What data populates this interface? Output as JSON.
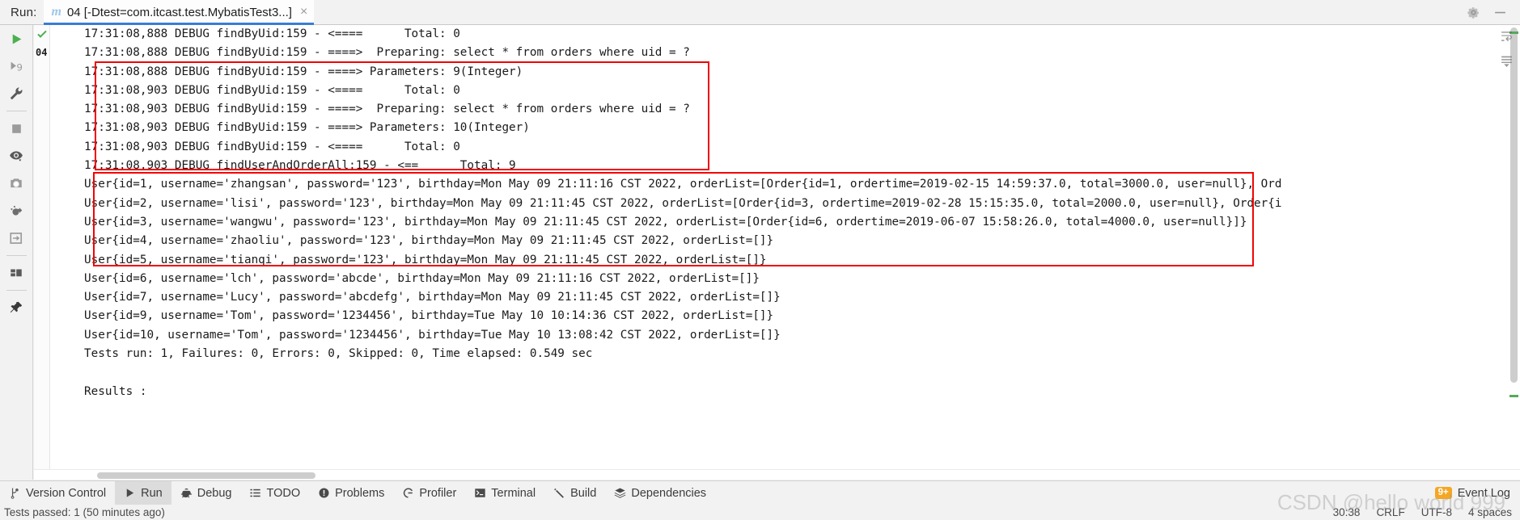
{
  "window": {
    "run_label": "Run:",
    "tab": {
      "icon": "maven-m-icon",
      "title": "04 [-Dtest=com.itcast.test.MybatisTest3...]",
      "close": "×"
    },
    "header_icons": [
      "gear-icon",
      "minimize-icon"
    ],
    "right_rail_icons": [
      "wrap-text-icon",
      "scroll-to-end-icon"
    ]
  },
  "toolstrip": {
    "items": [
      {
        "name": "rerun-button",
        "icon": "play-icon"
      },
      {
        "name": "rerun-failed-tests-button",
        "icon": "rerun-failed-icon"
      },
      {
        "name": "edit-configurations-button",
        "icon": "wrench-icon"
      },
      {
        "name": "stop-button",
        "icon": "stop-square-icon"
      },
      {
        "name": "filter-tests-button",
        "icon": "eye-icon"
      },
      {
        "name": "export-test-results-button",
        "icon": "camera-icon"
      },
      {
        "name": "attach-profiler-button",
        "icon": "bug-arrow-icon"
      },
      {
        "name": "scroll-to-stacktrace-button",
        "icon": "arrow-into-box-icon"
      },
      {
        "name": "layout-button",
        "icon": "layout-icon"
      },
      {
        "name": "pin-tab-button",
        "icon": "pin-icon"
      }
    ]
  },
  "console": {
    "gutter_number": "04",
    "lines": [
      "17:31:08,888 DEBUG findByUid:159 - <====      Total: 0",
      "17:31:08,888 DEBUG findByUid:159 - ====>  Preparing: select * from orders where uid = ?",
      "17:31:08,888 DEBUG findByUid:159 - ====> Parameters: 9(Integer)",
      "17:31:08,903 DEBUG findByUid:159 - <====      Total: 0",
      "17:31:08,903 DEBUG findByUid:159 - ====>  Preparing: select * from orders where uid = ?",
      "17:31:08,903 DEBUG findByUid:159 - ====> Parameters: 10(Integer)",
      "17:31:08,903 DEBUG findByUid:159 - <====      Total: 0",
      "17:31:08,903 DEBUG findUserAndOrderAll:159 - <==      Total: 9",
      "User{id=1, username='zhangsan', password='123', birthday=Mon May 09 21:11:16 CST 2022, orderList=[Order{id=1, ordertime=2019-02-15 14:59:37.0, total=3000.0, user=null}, Ord",
      "User{id=2, username='lisi', password='123', birthday=Mon May 09 21:11:45 CST 2022, orderList=[Order{id=3, ordertime=2019-02-28 15:15:35.0, total=2000.0, user=null}, Order{i",
      "User{id=3, username='wangwu', password='123', birthday=Mon May 09 21:11:45 CST 2022, orderList=[Order{id=6, ordertime=2019-06-07 15:58:26.0, total=4000.0, user=null}]}",
      "User{id=4, username='zhaoliu', password='123', birthday=Mon May 09 21:11:45 CST 2022, orderList=[]}",
      "User{id=5, username='tianqi', password='123', birthday=Mon May 09 21:11:45 CST 2022, orderList=[]}",
      "User{id=6, username='lch', password='abcde', birthday=Mon May 09 21:11:16 CST 2022, orderList=[]}",
      "User{id=7, username='Lucy', password='abcdefg', birthday=Mon May 09 21:11:45 CST 2022, orderList=[]}",
      "User{id=9, username='Tom', password='1234456', birthday=Tue May 10 10:14:36 CST 2022, orderList=[]}",
      "User{id=10, username='Tom', password='1234456', birthday=Tue May 10 13:08:42 CST 2022, orderList=[]}",
      "Tests run: 1, Failures: 0, Errors: 0, Skipped: 0, Time elapsed: 0.549 sec",
      "",
      "Results :",
      ""
    ]
  },
  "bottom_bar": {
    "items": [
      {
        "label": "Version Control",
        "icon": "branch-icon",
        "active": false
      },
      {
        "label": "Run",
        "icon": "play-icon",
        "active": true
      },
      {
        "label": "Debug",
        "icon": "bug-icon",
        "active": false
      },
      {
        "label": "TODO",
        "icon": "list-icon",
        "active": false
      },
      {
        "label": "Problems",
        "icon": "error-circle-icon",
        "active": false
      },
      {
        "label": "Profiler",
        "icon": "profiler-icon",
        "active": false
      },
      {
        "label": "Terminal",
        "icon": "terminal-icon",
        "active": false
      },
      {
        "label": "Build",
        "icon": "hammer-icon",
        "active": false
      },
      {
        "label": "Dependencies",
        "icon": "layers-icon",
        "active": false
      }
    ],
    "event_log": {
      "badge": "9+",
      "label": "Event Log"
    }
  },
  "status_bar": {
    "left": "Tests passed: 1 (50 minutes ago)",
    "right": [
      "30:38",
      "CRLF",
      "UTF-8",
      "4 spaces"
    ]
  },
  "watermark": "CSDN @hello world 999",
  "colors": {
    "accent": "#3a7dd1",
    "annotation_red": "#f10404",
    "badge_orange": "#f5a623",
    "run_green": "#4caf50",
    "panel_bg": "#f2f2f2",
    "console_bg": "#ffffff"
  }
}
